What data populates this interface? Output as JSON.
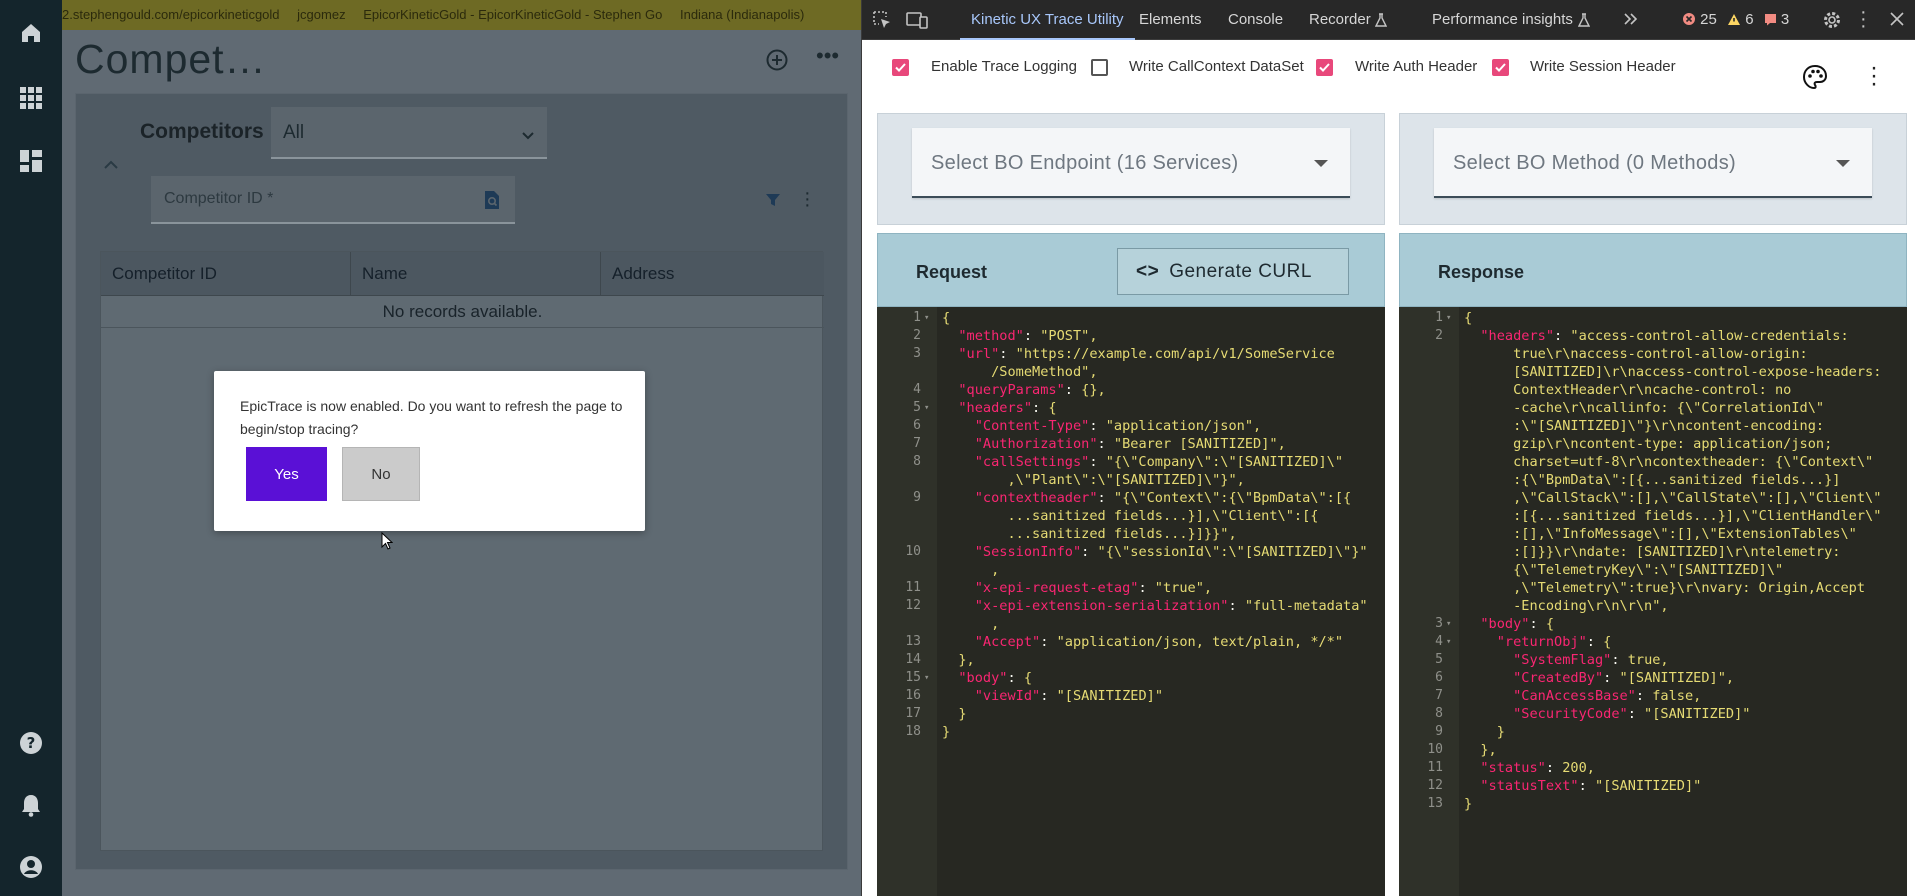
{
  "app": {
    "infobar": [
      "2.stephengould.com/epicorkineticgold",
      "jcgomez",
      "EpicorKineticGold - EpicorKineticGold - Stephen Go",
      "Indiana (Indianapolis)"
    ],
    "title": "Compet…",
    "competitors_label": "Competitors",
    "competitors_filter": "All",
    "competitor_id_placeholder": "Competitor ID *",
    "columns": [
      "Competitor ID",
      "Name",
      "Address"
    ],
    "empty_message": "No records available."
  },
  "dialog": {
    "message": "EpicTrace is now enabled. Do you want to refresh the page to begin/stop tracing?",
    "yes": "Yes",
    "no": "No"
  },
  "devtools": {
    "tabs": [
      "Kinetic UX Trace Utility",
      "Elements",
      "Console",
      "Recorder",
      "Performance insights"
    ],
    "errors": "25",
    "warnings": "6",
    "issues": "3",
    "options": [
      {
        "label": "Enable Trace Logging",
        "checked": true
      },
      {
        "label": "Write CallContext DataSet",
        "checked": false
      },
      {
        "label": "Write Auth Header",
        "checked": true
      },
      {
        "label": "Write Session Header",
        "checked": true
      }
    ],
    "bo_endpoint": "Select BO Endpoint (16 Services)",
    "bo_method": "Select BO Method (0 Methods)",
    "request_title": "Request",
    "generate_curl": "Generate CURL",
    "response_title": "Response",
    "request_lines": [
      {
        "n": "1",
        "fold": true,
        "t": "{"
      },
      {
        "n": "2",
        "t": "  \"method\": \"POST\","
      },
      {
        "n": "3",
        "t": "  \"url\": \"https://example.com/api/v1/SomeService"
      },
      {
        "n": "",
        "t": "      /SomeMethod\","
      },
      {
        "n": "4",
        "t": "  \"queryParams\": {},"
      },
      {
        "n": "5",
        "fold": true,
        "t": "  \"headers\": {"
      },
      {
        "n": "6",
        "t": "    \"Content-Type\": \"application/json\","
      },
      {
        "n": "7",
        "t": "    \"Authorization\": \"Bearer [SANITIZED]\","
      },
      {
        "n": "8",
        "t": "    \"callSettings\": \"{\\\"Company\\\":\\\"[SANITIZED]\\\""
      },
      {
        "n": "",
        "t": "        ,\\\"Plant\\\":\\\"[SANITIZED]\\\"}\","
      },
      {
        "n": "9",
        "t": "    \"contextheader\": \"{\\\"Context\\\":{\\\"BpmData\\\":[{"
      },
      {
        "n": "",
        "t": "        ...sanitized fields...}],\\\"Client\\\":[{"
      },
      {
        "n": "",
        "t": "        ...sanitized fields...}]}}\","
      },
      {
        "n": "10",
        "t": "    \"SessionInfo\": \"{\\\"sessionId\\\":\\\"[SANITIZED]\\\"}\""
      },
      {
        "n": "",
        "t": "      ,"
      },
      {
        "n": "11",
        "t": "    \"x-epi-request-etag\": \"true\","
      },
      {
        "n": "12",
        "t": "    \"x-epi-extension-serialization\": \"full-metadata\""
      },
      {
        "n": "",
        "t": "      ,"
      },
      {
        "n": "13",
        "t": "    \"Accept\": \"application/json, text/plain, */*\""
      },
      {
        "n": "14",
        "t": "  },"
      },
      {
        "n": "15",
        "fold": true,
        "t": "  \"body\": {"
      },
      {
        "n": "16",
        "t": "    \"viewId\": \"[SANITIZED]\""
      },
      {
        "n": "17",
        "t": "  }"
      },
      {
        "n": "18",
        "t": "}"
      }
    ],
    "response_lines": [
      {
        "n": "1",
        "fold": true,
        "t": "{"
      },
      {
        "n": "2",
        "t": "  \"headers\": \"access-control-allow-credentials:"
      },
      {
        "n": "",
        "t": "      true\\r\\naccess-control-allow-origin:"
      },
      {
        "n": "",
        "t": "      [SANITIZED]\\r\\naccess-control-expose-headers:"
      },
      {
        "n": "",
        "t": "      ContextHeader\\r\\ncache-control: no"
      },
      {
        "n": "",
        "t": "      -cache\\r\\ncallinfo: {\\\"CorrelationId\\\""
      },
      {
        "n": "",
        "t": "      :\\\"[SANITIZED]\\\"}\\r\\ncontent-encoding:"
      },
      {
        "n": "",
        "t": "      gzip\\r\\ncontent-type: application/json;"
      },
      {
        "n": "",
        "t": "      charset=utf-8\\r\\ncontextheader: {\\\"Context\\\""
      },
      {
        "n": "",
        "t": "      :{\\\"BpmData\\\":[{...sanitized fields...}]"
      },
      {
        "n": "",
        "t": "      ,\\\"CallStack\\\":[],\\\"CallState\\\":[],\\\"Client\\\""
      },
      {
        "n": "",
        "t": "      :[{...sanitized fields...}],\\\"ClientHandler\\\""
      },
      {
        "n": "",
        "t": "      :[],\\\"InfoMessage\\\":[],\\\"ExtensionTables\\\""
      },
      {
        "n": "",
        "t": "      :[]}}\\r\\ndate: [SANITIZED]\\r\\ntelemetry:"
      },
      {
        "n": "",
        "t": "      {\\\"TelemetryKey\\\":\\\"[SANITIZED]\\\""
      },
      {
        "n": "",
        "t": "      ,\\\"Telemetry\\\":true}\\r\\nvary: Origin,Accept"
      },
      {
        "n": "",
        "t": "      -Encoding\\r\\n\\r\\n\","
      },
      {
        "n": "3",
        "fold": true,
        "t": "  \"body\": {"
      },
      {
        "n": "4",
        "fold": true,
        "t": "    \"returnObj\": {"
      },
      {
        "n": "5",
        "t": "      \"SystemFlag\": true,"
      },
      {
        "n": "6",
        "t": "      \"CreatedBy\": \"[SANITIZED]\","
      },
      {
        "n": "7",
        "t": "      \"CanAccessBase\": false,"
      },
      {
        "n": "8",
        "t": "      \"SecurityCode\": \"[SANITIZED]\""
      },
      {
        "n": "9",
        "t": "    }"
      },
      {
        "n": "10",
        "t": "  },"
      },
      {
        "n": "11",
        "t": "  \"status\": 200,"
      },
      {
        "n": "12",
        "t": "  \"statusText\": \"[SANITIZED]\""
      },
      {
        "n": "13",
        "t": "}"
      }
    ]
  }
}
